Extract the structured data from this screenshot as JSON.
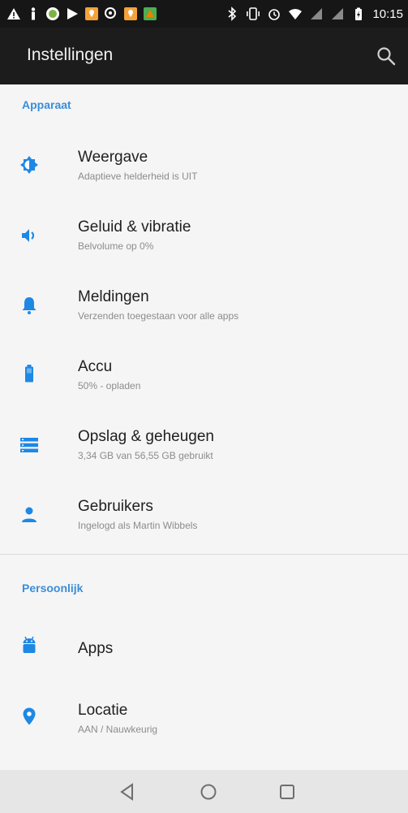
{
  "status_bar": {
    "time": "10:15"
  },
  "app_bar": {
    "title": "Instellingen",
    "search_icon": "search-icon"
  },
  "sections": [
    {
      "header": "Apparaat",
      "items": [
        {
          "title": "Weergave",
          "subtitle": "Adaptieve helderheid is UIT",
          "icon": "brightness-icon"
        },
        {
          "title": "Geluid & vibratie",
          "subtitle": "Belvolume op 0%",
          "icon": "volume-icon"
        },
        {
          "title": "Meldingen",
          "subtitle": "Verzenden toegestaan voor alle apps",
          "icon": "bell-icon"
        },
        {
          "title": "Accu",
          "subtitle": "50% - opladen",
          "icon": "battery-icon"
        },
        {
          "title": "Opslag & geheugen",
          "subtitle": "3,34 GB van 56,55 GB gebruikt",
          "icon": "storage-icon"
        },
        {
          "title": "Gebruikers",
          "subtitle": "Ingelogd als Martin Wibbels",
          "icon": "person-icon"
        }
      ]
    },
    {
      "header": "Persoonlijk",
      "items": [
        {
          "title": "Apps",
          "subtitle": "",
          "icon": "android-icon"
        },
        {
          "title": "Locatie",
          "subtitle": "AAN / Nauwkeurig",
          "icon": "location-pin-icon"
        }
      ]
    }
  ],
  "nav_bar": {
    "back": "back-icon",
    "home": "home-icon",
    "recents": "recents-icon"
  },
  "colors": {
    "accent": "#3a8ed8",
    "icon": "#1e88e5",
    "statusbar": "#161616",
    "appbar": "#1c1c1c"
  }
}
